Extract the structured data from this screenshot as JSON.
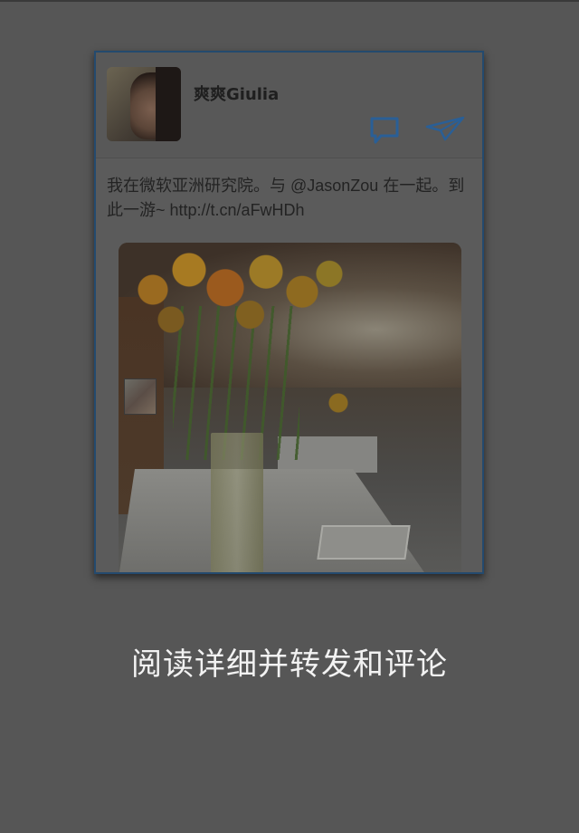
{
  "card": {
    "username": "爽爽Giulia",
    "text": "我在微软亚洲研究院。与 @JasonZou 在一起。到此一游~  http://t.cn/aFwHDh",
    "photo_alt": "flowers in a vase on an office table",
    "actions": {
      "comment_icon": "comment-icon",
      "repost_icon": "send-icon"
    }
  },
  "caption": "阅读详细并转发和评论",
  "colors": {
    "overlay": "#565656",
    "card_border": "#244a6e",
    "icon_blue": "#2a5f96",
    "caption": "#f2f2f2"
  }
}
